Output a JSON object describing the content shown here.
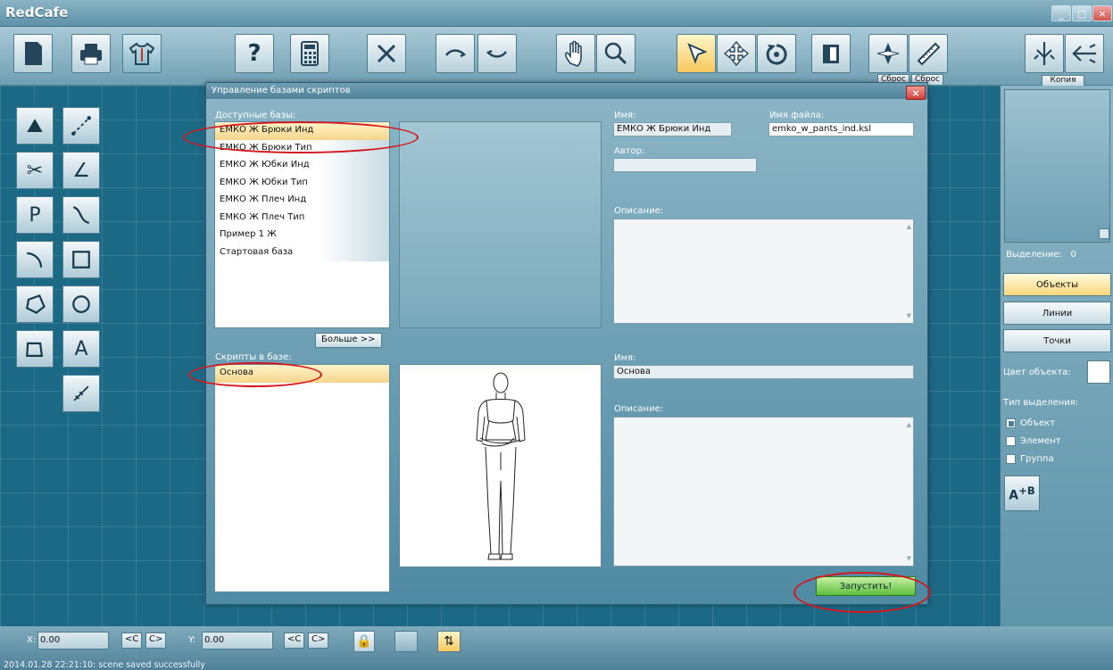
{
  "app": {
    "title": "RedCafe"
  },
  "window_controls": {
    "minimize": "_",
    "maximize": "□",
    "close": "×"
  },
  "toolbar": {
    "reset_label_1": "Сброс",
    "reset_label_2": "Сброс",
    "copy_label": "Копия",
    "icons": [
      "new-document-icon",
      "print-icon",
      "shirt-icon",
      "help-icon",
      "calculator-icon",
      "cancel-icon",
      "undo-icon",
      "redo-icon",
      "hand-icon",
      "zoom-icon",
      "pointer-icon",
      "move-icon",
      "rotate-icon",
      "mirror-icon",
      "compass-icon",
      "ruler-icon",
      "split-icon",
      "merge-icon"
    ]
  },
  "dialog": {
    "title": "Управление базами скриптов",
    "close": "×",
    "bases_label": "Доступные базы:",
    "bases": [
      "ЕМКО Ж Брюки Инд",
      "ЕМКО Ж Брюки Тип",
      "ЕМКО Ж Юбки Инд",
      "ЕМКО Ж Юбки Тип",
      "ЕМКО Ж Плеч Инд",
      "ЕМКО Ж Плеч Тип",
      "Пример 1 Ж",
      "Стартовая база"
    ],
    "more_button": "Больше >>",
    "scripts_label": "Скрипты в базе:",
    "scripts": [
      "Основа"
    ],
    "base_name_label": "Имя:",
    "base_name_value": "ЕМКО Ж Брюки Инд",
    "file_name_label": "Имя файла:",
    "file_name_value": "emko_w_pants_ind.ksl",
    "author_label": "Автор:",
    "author_value": "",
    "base_desc_label": "Описание:",
    "script_name_label": "Имя:",
    "script_name_value": "Основа",
    "script_desc_label": "Описание:",
    "run_button": "Запустить!"
  },
  "right_panel": {
    "selection_label": "Выделение:",
    "selection_count": "0",
    "objects_button": "Объекты",
    "lines_button": "Линии",
    "points_button": "Точки",
    "object_color_label": "Цвет объекта:",
    "select_type_label": "Тип выделения:",
    "select_options": [
      "Объект",
      "Элемент",
      "Группа"
    ],
    "select_checked": "Объект"
  },
  "statusbar": {
    "x_label": "X:",
    "x_value": "0.00",
    "y_label": "Y:",
    "y_value": "0.00",
    "prev": "<C",
    "next": "C>",
    "log": "2014.01.28 22:21:10: scene saved successfully"
  },
  "colors": {
    "canvas": "#1c6985",
    "highlight_ellipse": "#d5161c",
    "run_button": "#5fbf3f",
    "selection": "#f5d58a"
  }
}
